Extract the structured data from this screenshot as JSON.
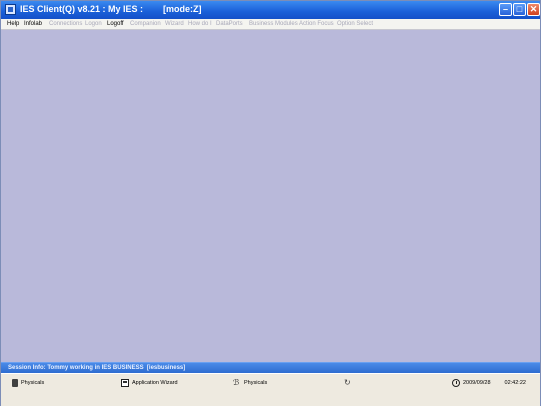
{
  "window": {
    "title": "IES Client(Q) v8.21 : My IES :        [mode:Z]"
  },
  "menu": {
    "items": [
      {
        "label": "Help",
        "enabled": true
      },
      {
        "label": "Infolab",
        "enabled": true
      },
      {
        "label": "Connections",
        "enabled": false
      },
      {
        "label": "Logon",
        "enabled": false
      },
      {
        "label": "Logoff",
        "enabled": true
      },
      {
        "label": "Companion",
        "enabled": false
      },
      {
        "label": "Wizard",
        "enabled": false
      },
      {
        "label": "How do I",
        "enabled": false
      },
      {
        "label": "DataPorts",
        "enabled": false
      },
      {
        "label": "Business Modules",
        "enabled": false
      },
      {
        "label": "Action Focus",
        "enabled": false
      },
      {
        "label": "Option Select",
        "enabled": false
      }
    ]
  },
  "session": {
    "info": "Session Info: Tommy working in IES BUSINESS  [iesbusiness]"
  },
  "statusbar": {
    "item1": "Physicals",
    "item2": "Application Wizard",
    "item3": "Physicals",
    "date": "2009/09/28",
    "time": "02:42:22"
  },
  "colors": {
    "client_bg": "#b9b9da",
    "titlebar": "#1a5fd8",
    "session_bar": "#3a78dc"
  }
}
